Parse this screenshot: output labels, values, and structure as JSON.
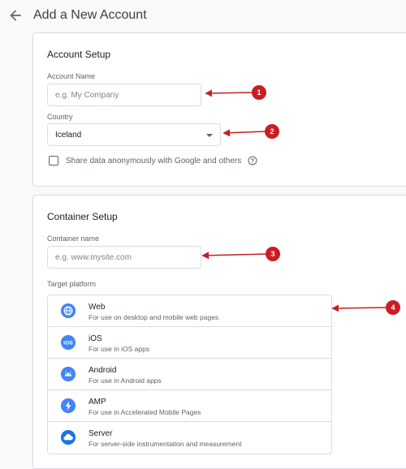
{
  "header": {
    "title": "Add a New Account"
  },
  "account_setup": {
    "title": "Account Setup",
    "account_name_label": "Account Name",
    "account_name_placeholder": "e.g. My Company",
    "country_label": "Country",
    "country_value": "Iceland",
    "share_data_label": "Share data anonymously with Google and others"
  },
  "container_setup": {
    "title": "Container Setup",
    "container_name_label": "Container name",
    "container_name_placeholder": "e.g. www.mysite.com",
    "target_platform_label": "Target platform",
    "platforms": [
      {
        "name": "Web",
        "description": "For use on desktop and mobile web pages",
        "icon": "globe-icon"
      },
      {
        "name": "iOS",
        "description": "For use in iOS apps",
        "icon": "ios-icon"
      },
      {
        "name": "Android",
        "description": "For use in Android apps",
        "icon": "android-icon"
      },
      {
        "name": "AMP",
        "description": "For use in Accelerated Mobile Pages",
        "icon": "amp-bolt-icon"
      },
      {
        "name": "Server",
        "description": "For server-side instrumentation and measurement",
        "icon": "cloud-icon"
      }
    ]
  },
  "annotations": [
    "1",
    "2",
    "3",
    "4"
  ],
  "colors": {
    "annotation": "#c81e24",
    "platform_icon": "#4285f4"
  }
}
